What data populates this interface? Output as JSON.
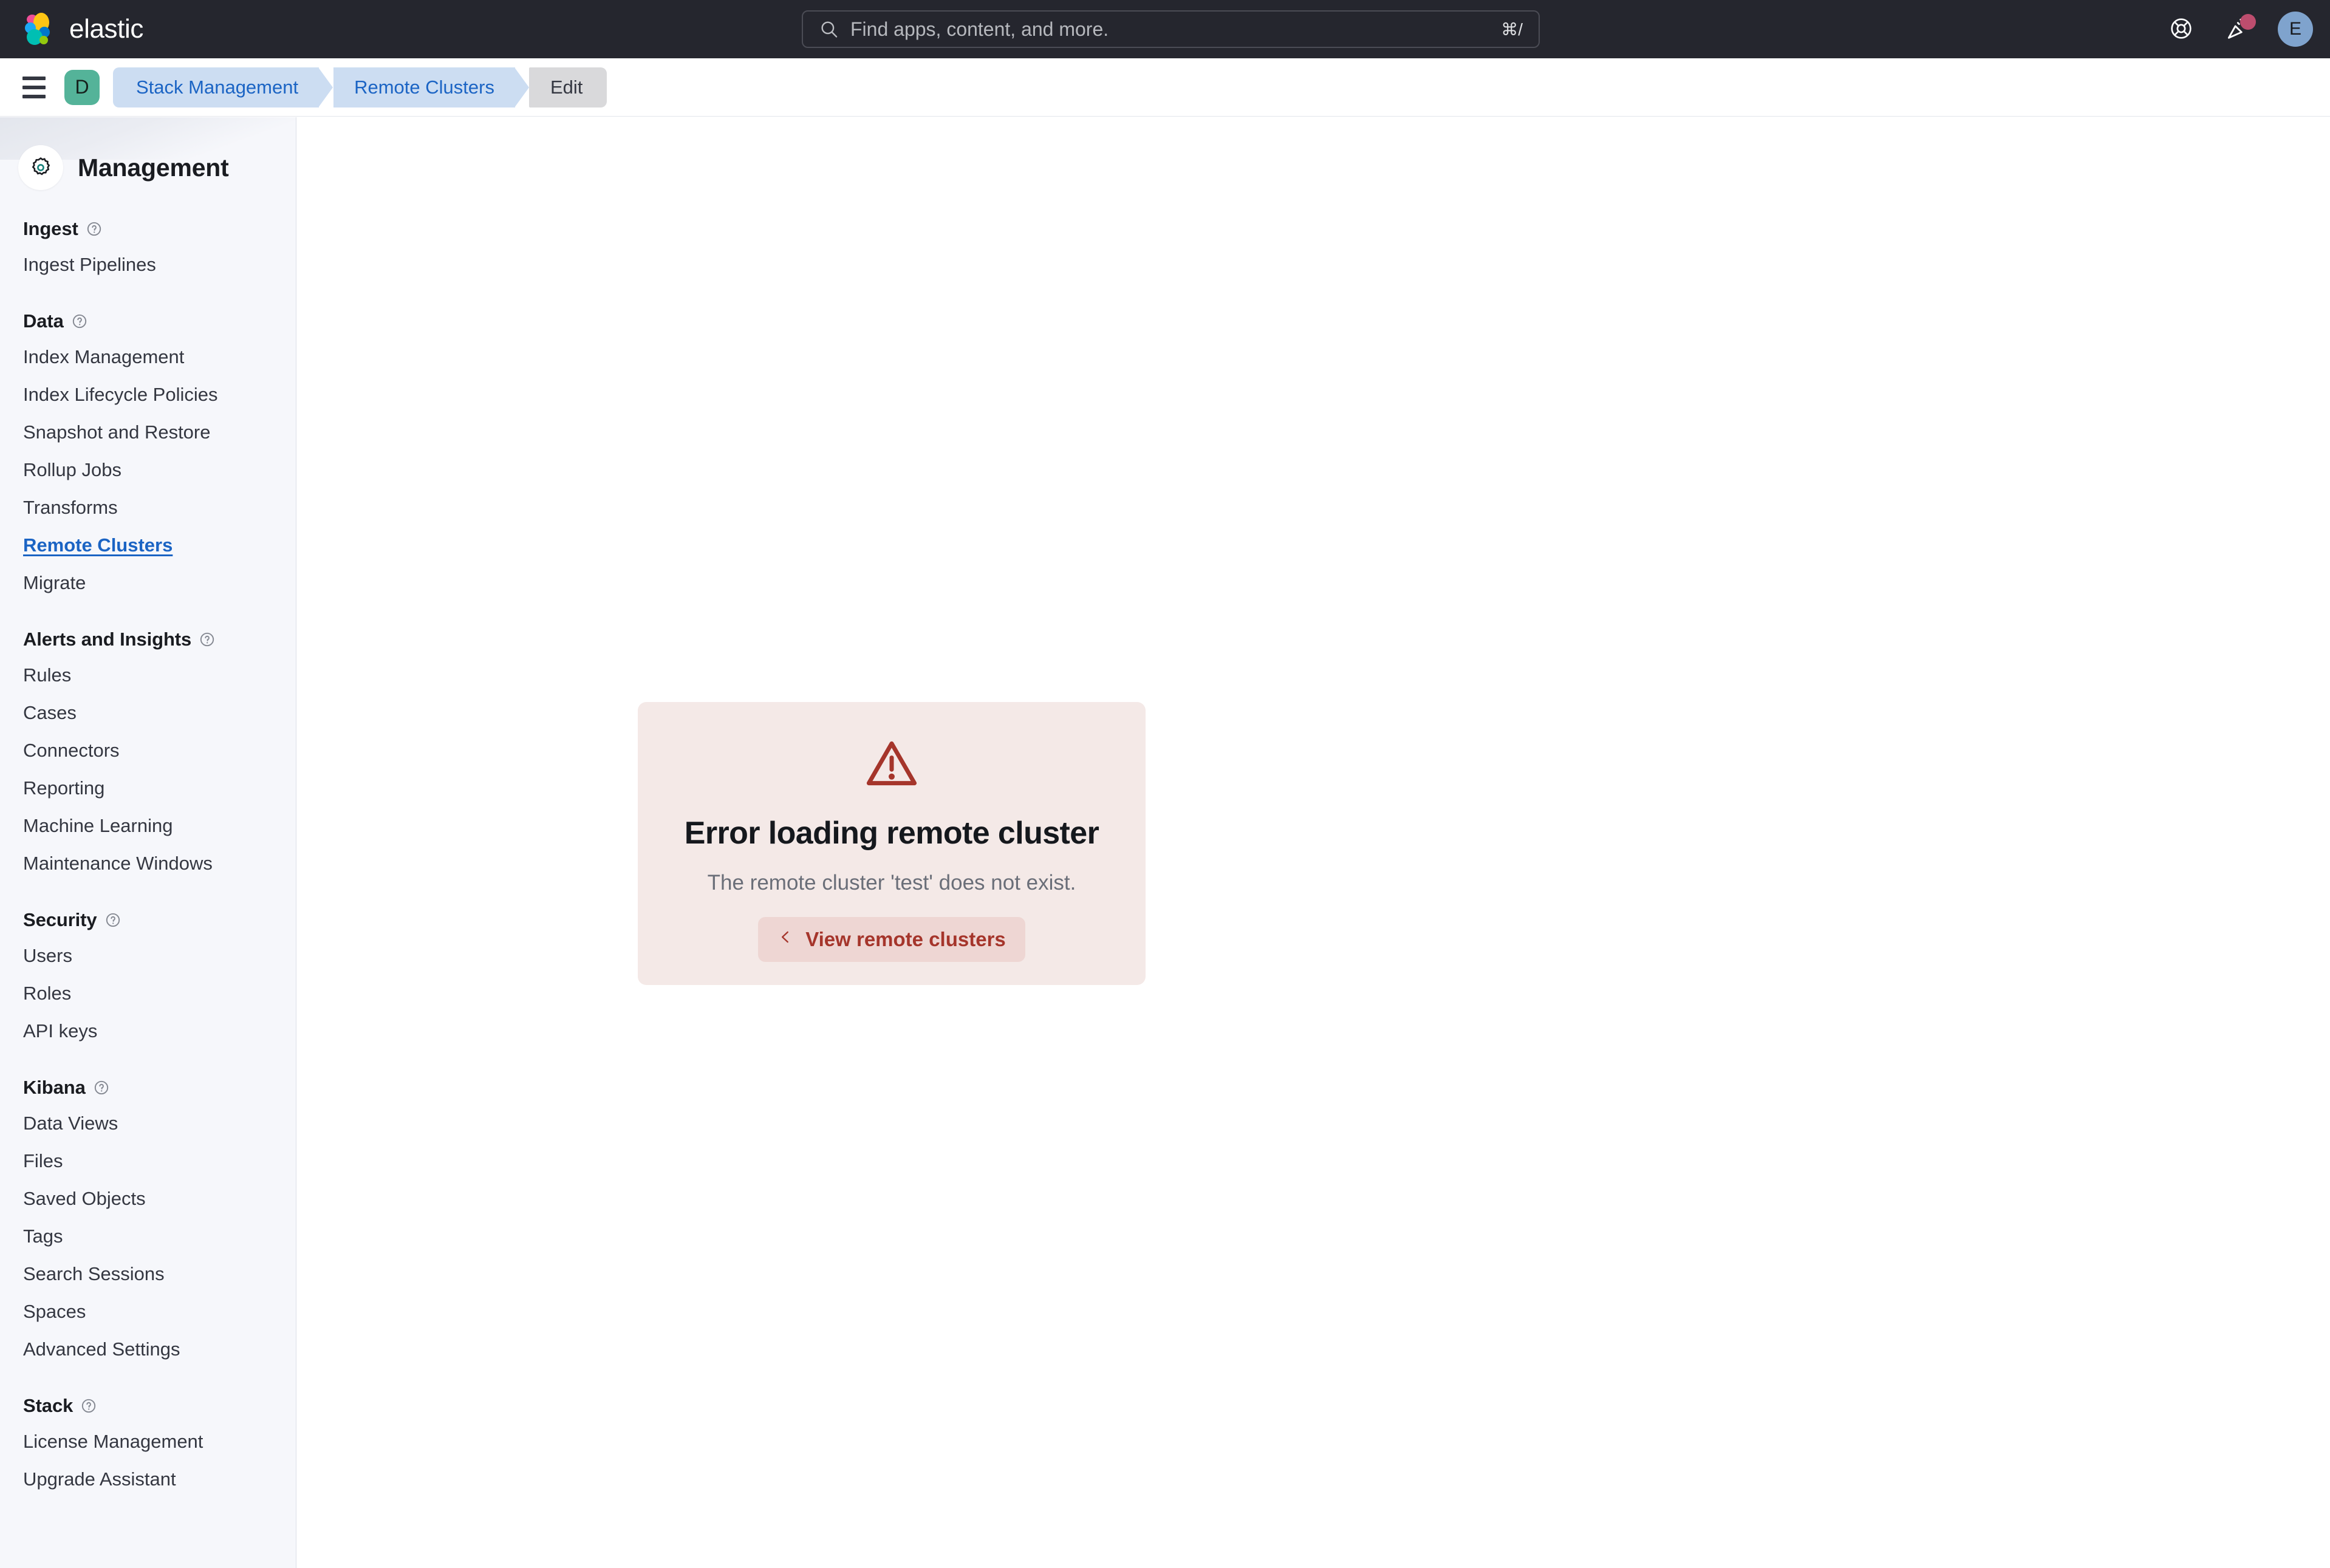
{
  "header": {
    "brand_name": "elastic",
    "brand_logo_icon": "elastic-logo-icon",
    "search": {
      "placeholder": "Find apps, content, and more.",
      "value": "",
      "shortcut": "⌘/",
      "icon": "search-icon"
    },
    "actions": [
      {
        "name": "help-menu-button",
        "icon": "life-ring-icon",
        "badge": null
      },
      {
        "name": "news-feed-button",
        "icon": "party-popper-icon",
        "badge": "unread"
      }
    ],
    "user_avatar": {
      "initial": "E",
      "color": "#7FA3CD"
    }
  },
  "breadcrumb_bar": {
    "menu_button_icon": "hamburger-menu-icon",
    "space": {
      "initial": "D",
      "color": "#54B399"
    },
    "crumbs": [
      {
        "label": "Stack Management",
        "current": false
      },
      {
        "label": "Remote Clusters",
        "current": false
      },
      {
        "label": "Edit",
        "current": true
      }
    ]
  },
  "sidebar": {
    "icon": "gear-icon",
    "title": "Management",
    "sections": [
      {
        "title": "Ingest",
        "help_icon": "question-in-circle-icon",
        "items": [
          {
            "label": "Ingest Pipelines",
            "active": false
          }
        ]
      },
      {
        "title": "Data",
        "help_icon": "question-in-circle-icon",
        "items": [
          {
            "label": "Index Management",
            "active": false
          },
          {
            "label": "Index Lifecycle Policies",
            "active": false
          },
          {
            "label": "Snapshot and Restore",
            "active": false
          },
          {
            "label": "Rollup Jobs",
            "active": false
          },
          {
            "label": "Transforms",
            "active": false
          },
          {
            "label": "Remote Clusters",
            "active": true
          },
          {
            "label": "Migrate",
            "active": false
          }
        ]
      },
      {
        "title": "Alerts and Insights",
        "help_icon": "question-in-circle-icon",
        "items": [
          {
            "label": "Rules",
            "active": false
          },
          {
            "label": "Cases",
            "active": false
          },
          {
            "label": "Connectors",
            "active": false
          },
          {
            "label": "Reporting",
            "active": false
          },
          {
            "label": "Machine Learning",
            "active": false
          },
          {
            "label": "Maintenance Windows",
            "active": false
          }
        ]
      },
      {
        "title": "Security",
        "help_icon": "question-in-circle-icon",
        "items": [
          {
            "label": "Users",
            "active": false
          },
          {
            "label": "Roles",
            "active": false
          },
          {
            "label": "API keys",
            "active": false
          }
        ]
      },
      {
        "title": "Kibana",
        "help_icon": "question-in-circle-icon",
        "items": [
          {
            "label": "Data Views",
            "active": false
          },
          {
            "label": "Files",
            "active": false
          },
          {
            "label": "Saved Objects",
            "active": false
          },
          {
            "label": "Tags",
            "active": false
          },
          {
            "label": "Search Sessions",
            "active": false
          },
          {
            "label": "Spaces",
            "active": false
          },
          {
            "label": "Advanced Settings",
            "active": false
          }
        ]
      },
      {
        "title": "Stack",
        "help_icon": "question-in-circle-icon",
        "items": [
          {
            "label": "License Management",
            "active": false
          },
          {
            "label": "Upgrade Assistant",
            "active": false
          }
        ]
      }
    ]
  },
  "main": {
    "error_panel": {
      "icon": "warning-triangle-icon",
      "title": "Error loading remote cluster",
      "message": "The remote cluster 'test' does not exist.",
      "action_label": "View remote clusters",
      "action_icon": "chevron-left-icon",
      "accent_color": "#A5352B",
      "background_color": "#F4E9E7",
      "button_background_color": "#EED6D3"
    }
  }
}
